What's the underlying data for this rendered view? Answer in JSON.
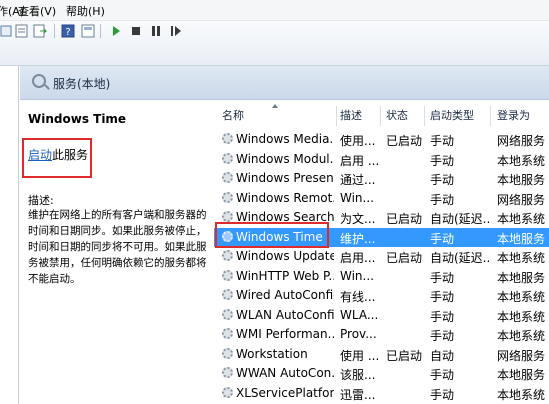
{
  "menu": [
    "操作(A)",
    "查看(V)",
    "帮助(H)"
  ],
  "header": {
    "title": "服务(本地)"
  },
  "detail": {
    "service_name": "Windows Time",
    "action_link": "启动",
    "action_suffix": "此服务",
    "desc_label": "描述:",
    "desc_text": "维护在网络上的所有客户端和服务器的时间和日期同步。如果此服务被停止，时间和日期的同步将不可用。如果此服务被禁用，任何明确依赖它的服务都将不能启动。"
  },
  "columns": [
    "名称",
    "描述",
    "状态",
    "启动类型",
    "登录为"
  ],
  "rows": [
    {
      "name": "Windows Media...",
      "desc": "使用...",
      "status": "已启动",
      "startup": "手动",
      "logon": "网络服务"
    },
    {
      "name": "Windows Modul...",
      "desc": "启用 ...",
      "status": "",
      "startup": "手动",
      "logon": "本地系统"
    },
    {
      "name": "Windows Presen...",
      "desc": "通过...",
      "status": "",
      "startup": "手动",
      "logon": "本地服务"
    },
    {
      "name": "Windows Remot...",
      "desc": "Win...",
      "status": "",
      "startup": "手动",
      "logon": "网络服务"
    },
    {
      "name": "Windows Search",
      "desc": "为文...",
      "status": "已启动",
      "startup": "自动(延迟...",
      "logon": "本地系统"
    },
    {
      "name": "Windows Time",
      "desc": "维护...",
      "status": "",
      "startup": "手动",
      "logon": "本地服务"
    },
    {
      "name": "Windows Update",
      "desc": "启用...",
      "status": "已启动",
      "startup": "自动(延迟...",
      "logon": "本地系统"
    },
    {
      "name": "WinHTTP Web P...",
      "desc": "Win...",
      "status": "",
      "startup": "手动",
      "logon": "本地服务"
    },
    {
      "name": "Wired AutoConfig",
      "desc": "有线...",
      "status": "",
      "startup": "手动",
      "logon": "本地系统"
    },
    {
      "name": "WLAN AutoConfig",
      "desc": "WLA...",
      "status": "",
      "startup": "手动",
      "logon": "本地系统"
    },
    {
      "name": "WMI Performan...",
      "desc": "Prov...",
      "status": "",
      "startup": "手动",
      "logon": "本地系统"
    },
    {
      "name": "Workstation",
      "desc": "使用 ...",
      "status": "已启动",
      "startup": "自动",
      "logon": "网络服务"
    },
    {
      "name": "WWAN AutoCon...",
      "desc": "该服...",
      "status": "",
      "startup": "手动",
      "logon": "本地服务"
    },
    {
      "name": "XLServicePlatform",
      "desc": "迅雷...",
      "status": "",
      "startup": "手动",
      "logon": "本地系统"
    }
  ],
  "selected_row_index": 5
}
